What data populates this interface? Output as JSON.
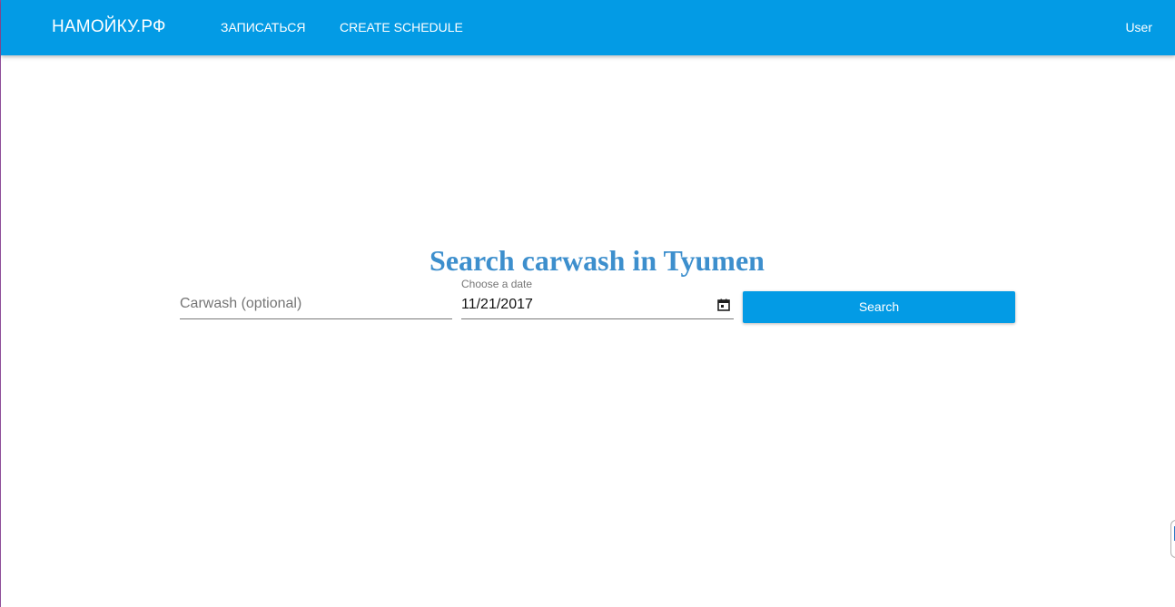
{
  "header": {
    "brand": "НАМОЙКУ.РФ",
    "nav": [
      "ЗАПИСАТЬСЯ",
      "CREATE SCHEDULE"
    ],
    "user": "User"
  },
  "main": {
    "title": "Search carwash in Tyumen",
    "carwash_placeholder": "Carwash (optional)",
    "date_label": "Choose a date",
    "date_value": "11/21/2017",
    "search_label": "Search"
  },
  "icons": {
    "calendar": "calendar-icon"
  },
  "colors": {
    "appbar": "#039be5",
    "title": "#3d8fcd",
    "button": "#039be5"
  }
}
